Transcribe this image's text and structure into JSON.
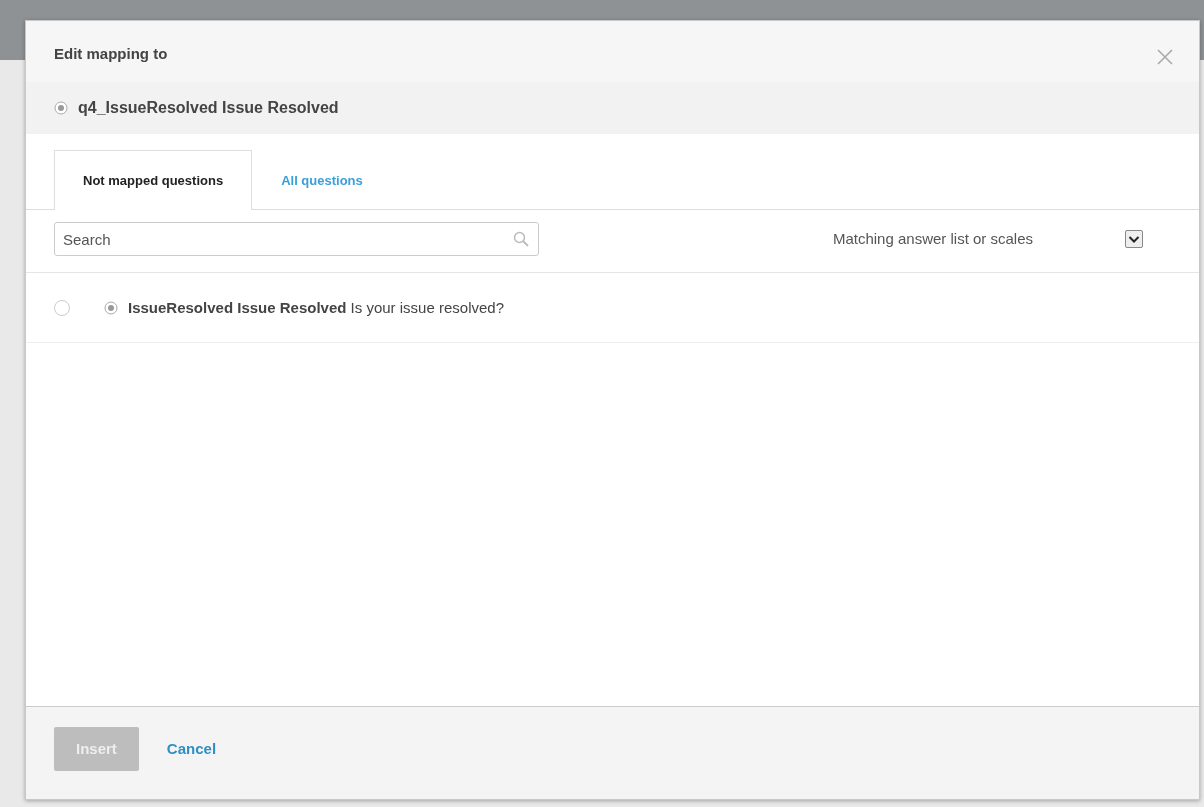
{
  "dialog": {
    "title": "Edit mapping to",
    "target": "q4_IssueResolved Issue Resolved"
  },
  "tabs": [
    {
      "label": "Not mapped questions",
      "selected": true
    },
    {
      "label": "All questions",
      "selected": false
    }
  ],
  "search": {
    "placeholder": "Search"
  },
  "filter": {
    "label": "Matching answer list or scales",
    "checked": true
  },
  "questions": [
    {
      "text": "**IssueResolved Issue Resolved** Is your issue resolved?",
      "selected": false
    }
  ],
  "buttons": [
    {
      "label": "Insert",
      "kind": "primary",
      "disabled": true
    },
    {
      "label": "Cancel",
      "kind": "link",
      "disabled": false
    }
  ]
}
